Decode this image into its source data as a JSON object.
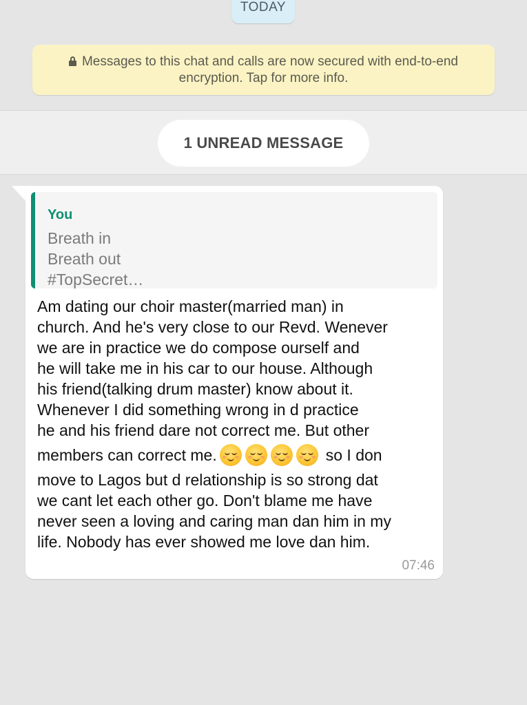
{
  "date_chip": {
    "label": "TODAY"
  },
  "encryption_banner": {
    "icon": "lock-icon",
    "text": "Messages to this chat and calls are now secured with end-to-end encryption. Tap for more info."
  },
  "unread_divider": {
    "label": "1 UNREAD MESSAGE"
  },
  "message": {
    "quoted": {
      "author": "You",
      "lines": [
        "Breath in",
        "Breath out",
        "#TopSecret…"
      ]
    },
    "lines_before_emoji": [
      "Am dating our choir master(married man) in",
      "church. And he's very close to our Revd. Wenever",
      "we are in practice we do compose ourself and",
      "he will take me in his car to our house. Although",
      "his friend(talking drum master) know about it.",
      "Whenever I did something wrong in d practice",
      "he and his friend dare not correct me. But other"
    ],
    "emoji_line": {
      "before": "members can correct me.",
      "emoji": [
        "relieved-face-icon",
        "relieved-face-icon",
        "relieved-face-icon",
        "relieved-face-icon"
      ],
      "after": "so I don"
    },
    "lines_after_emoji": [
      "move to Lagos but d relationship is so strong dat",
      "we cant let each other go. Don't blame me have",
      "never seen a loving and caring man dan him in my",
      "life. Nobody has ever showed me love dan him."
    ],
    "time": "07:46"
  },
  "colors": {
    "chat_background": "#e5e5e5",
    "quote_accent": "#0e8f72",
    "banner_background": "#fbf3c4",
    "date_chip_background": "#d9eef7"
  }
}
